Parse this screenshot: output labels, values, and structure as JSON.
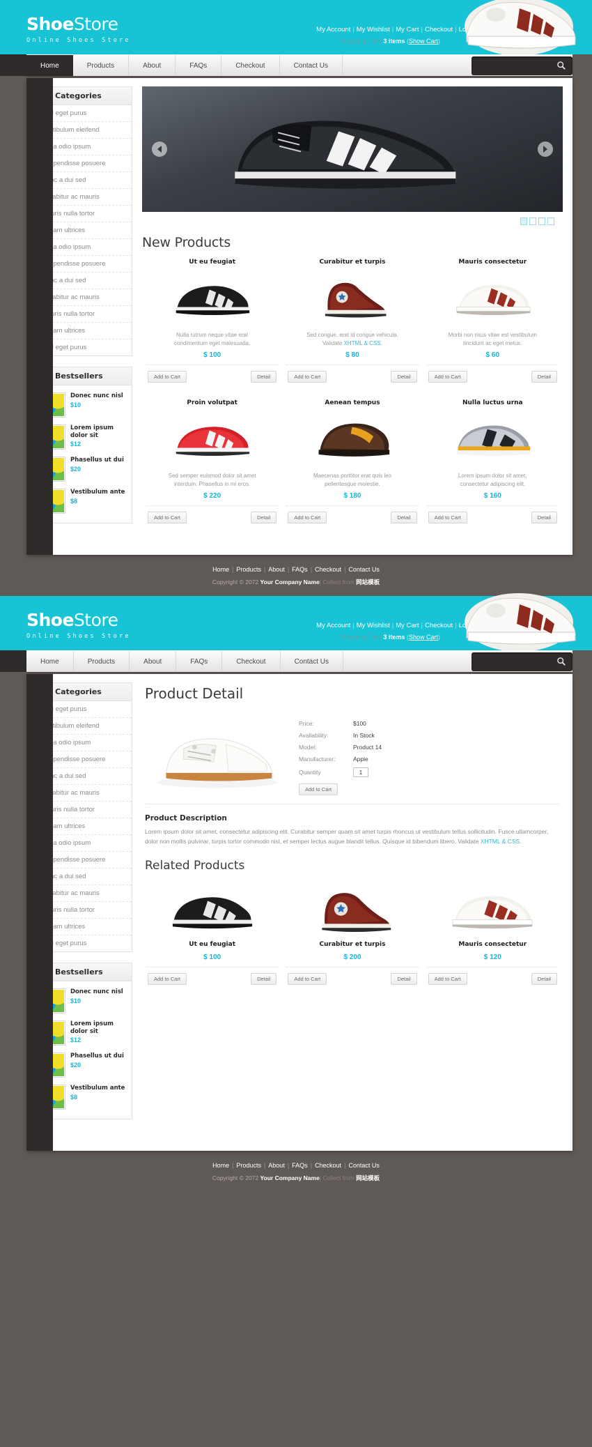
{
  "brand": {
    "name_bold": "Shoe",
    "name_light": "Store",
    "tagline": "Online Shoes Store"
  },
  "toplinks": [
    {
      "label": "My Account"
    },
    {
      "label": "My Wishlist"
    },
    {
      "label": "My Cart"
    },
    {
      "label": "Checkout"
    },
    {
      "label": "Log In"
    }
  ],
  "cart": {
    "prefix": "Shopping Cart:",
    "qty": "3 items",
    "open": "(",
    "show": "Show Cart",
    "close": ")"
  },
  "nav": [
    {
      "label": "Home",
      "active": true
    },
    {
      "label": "Products",
      "active": false
    },
    {
      "label": "About",
      "active": false
    },
    {
      "label": "FAQs",
      "active": false
    },
    {
      "label": "Checkout",
      "active": false
    },
    {
      "label": "Contact Us",
      "active": false
    }
  ],
  "search": {
    "value": "",
    "placeholder": ""
  },
  "sidebar": {
    "categories_title": "Categories",
    "categories": [
      "Sed eget purus",
      "Vestibulum eleifend",
      "Nulla odio ipsum",
      "Suspendisse posuere",
      "Nunc a dui sed",
      "Curabitur ac mauris",
      "Mauris nulla tortor",
      "Nullam ultrices",
      "Nulla odio ipsum",
      "Suspendisse posuere",
      "Nunc a dui sed",
      "Curabitur ac mauris",
      "Mauris nulla tortor",
      "Nullam ultrices",
      "Sed eget purus"
    ],
    "bestsellers_title": "Bestsellers",
    "bestsellers": [
      {
        "name": "Donec nunc nisl",
        "price": "$10"
      },
      {
        "name": "Lorem ipsum dolor sit",
        "price": "$12"
      },
      {
        "name": "Phasellus ut dui",
        "price": "$20"
      },
      {
        "name": "Vestibulum ante",
        "price": "$8"
      }
    ]
  },
  "home": {
    "new_products_title": "New Products",
    "products": [
      {
        "name": "Ut eu feugiat",
        "desc_1": "Nulla rutrum neque vitae erat",
        "desc_2": "condimentum eget malesuada.",
        "link": "",
        "price": "$ 100",
        "add": "Add to Cart",
        "detail": "Detail"
      },
      {
        "name": "Curabitur et turpis",
        "desc_1": "Sed congue, erat id congue vehicula.",
        "desc_2": "Validate ",
        "link": "XHTML & CSS",
        "desc_3": ".",
        "price": "$ 80",
        "add": "Add to Cart",
        "detail": "Detail"
      },
      {
        "name": "Mauris consectetur",
        "desc_1": "Morbi non risus vitae est vestibulum",
        "desc_2": "tincidunt ac eget metus.",
        "link": "",
        "price": "$ 60",
        "add": "Add to Cart",
        "detail": "Detail"
      },
      {
        "name": "Proin volutpat",
        "desc_1": "Sed semper euismod dolor sit amet",
        "desc_2": "interdum. Phasellus in mi eros.",
        "link": "",
        "price": "$ 220",
        "add": "Add to Cart",
        "detail": "Detail"
      },
      {
        "name": "Aenean tempus",
        "desc_1": "Maecenas porttitor erat quis leo",
        "desc_2": "pellentesque molestie.",
        "link": "",
        "price": "$ 180",
        "add": "Add to Cart",
        "detail": "Detail"
      },
      {
        "name": "Nulla luctus urna",
        "desc_1": "Lorem ipsum dolor sit amet,",
        "desc_2": "consectetur adipiscing elit.",
        "link": "",
        "price": "$ 160",
        "add": "Add to Cart",
        "detail": "Detail"
      }
    ]
  },
  "detail": {
    "page_title": "Product Detail",
    "fields": [
      {
        "key": "Price:",
        "value": "$100"
      },
      {
        "key": "Availability:",
        "value": "In Stock"
      },
      {
        "key": "Model:",
        "value": "Product 14"
      },
      {
        "key": "Manufacturer:",
        "value": "Apple"
      }
    ],
    "quantity_label": "Quantity",
    "quantity_value": "1",
    "add_to_cart": "Add to Cart",
    "description_title": "Product Description",
    "description_1": "Lorem ipsum dolor sit amet, consectetur adipiscing elit. Curabitur semper quam sit amet turpis rhoncus ut vestibulum tellus",
    "description_2": "sollicitudin. Fusce ullamcorper, dolor non mollis pulvinar, turpis tortor commodo nisl, et semper lectus augue blandit tellus.",
    "description_3": "Quisque id bibendum libero. Validate ",
    "description_link": "XHTML & CSS",
    "description_4": ".",
    "related_title": "Related Products",
    "related": [
      {
        "name": "Ut eu feugiat",
        "price": "$ 100",
        "add": "Add to Cart",
        "detail": "Detail"
      },
      {
        "name": "Curabitur et turpis",
        "price": "$ 200",
        "add": "Add to Cart",
        "detail": "Detail"
      },
      {
        "name": "Mauris consectetur",
        "price": "$ 120",
        "add": "Add to Cart",
        "detail": "Detail"
      }
    ]
  },
  "footer": {
    "links": [
      "Home",
      "Products",
      "About",
      "FAQs",
      "Checkout",
      "Contact Us"
    ],
    "copyright_prefix": "Copyright © 2072 ",
    "company": "Your Company Name",
    "collect": " Collect from ",
    "collect_link": "网站模板"
  },
  "colors": {
    "teal": "#17c3d4",
    "dark": "#2f2b2a",
    "page_bg": "#605a57",
    "accent_price": "#17b5d4"
  },
  "icons": {
    "search": "search-icon",
    "panel_arrow": "play-arrow-icon",
    "slider_prev": "chevron-left-icon",
    "slider_next": "chevron-right-icon"
  }
}
